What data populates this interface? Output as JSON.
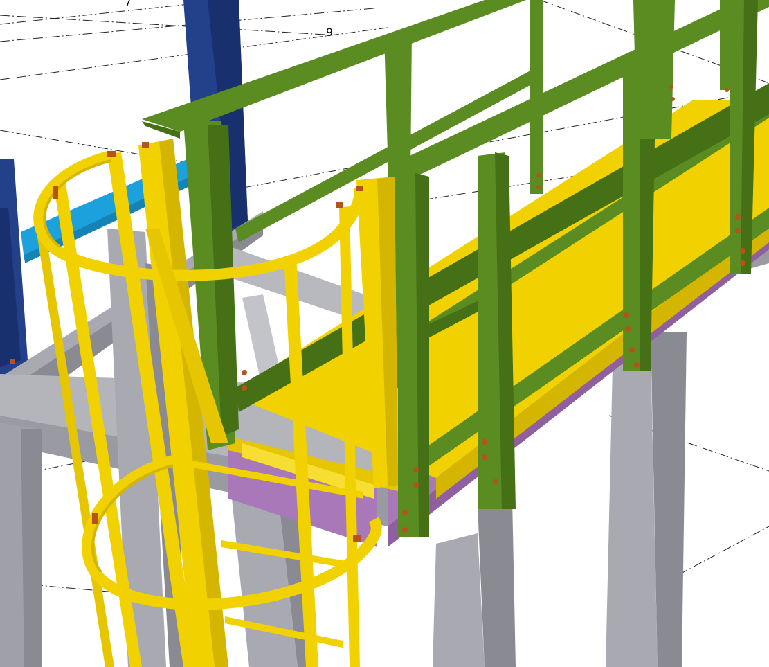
{
  "grid_labels": [
    "7",
    "9"
  ],
  "colors": {
    "background": "#ffffff",
    "grid_line": "#222222",
    "blue_column": "#23408a",
    "blue_column_dark": "#18306e",
    "cyan_beam": "#1da1dc",
    "gray_steel": "#a9a9b1",
    "gray_steel_dark": "#8a8a93",
    "gray_steel_light": "#c3c3ca",
    "purple_plate": "#a878b8",
    "yellow": "#f1d200",
    "yellow_dark": "#d4b600",
    "green": "#5a8c22",
    "green_dark": "#467016",
    "bolt": "#b5531a"
  }
}
